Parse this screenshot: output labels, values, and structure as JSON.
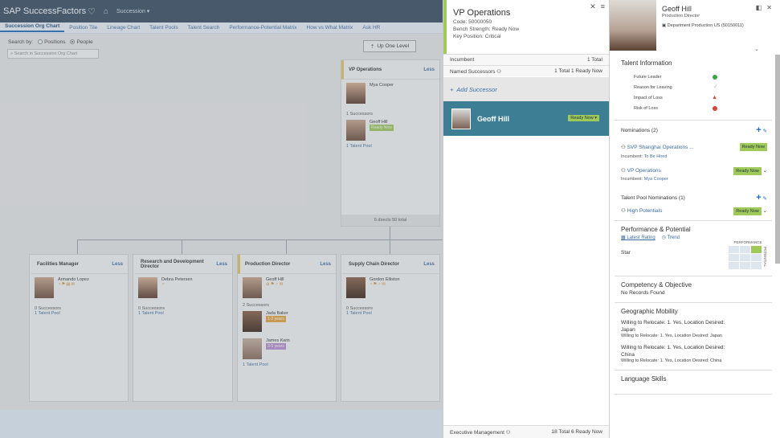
{
  "app": {
    "title": "SAP SuccessFactors",
    "module": "Succession"
  },
  "subnav": [
    "Succession Org Chart",
    "Position Tile",
    "Lineage Chart",
    "Talent Pools",
    "Talent Search",
    "Performance-Potential Matrix",
    "How vs What Matrix",
    "Ask HR"
  ],
  "search": {
    "label": "Search by:",
    "opt1": "Positions",
    "opt2": "People",
    "placeholder": "Search in Succession Org Chart"
  },
  "uplevel": "Up One Level",
  "top_node": {
    "title": "VP Operations",
    "less": "Less",
    "incumbent": "Mya Cooper",
    "succ_count": "1 Successors",
    "successor": "Geoff Hill",
    "successor_tag": "Ready Now",
    "pool": "1 Talent Pool",
    "footer": "6 directs 50 total"
  },
  "nodes": [
    {
      "title": "Facilities Manager",
      "less": "Less",
      "person": "Armando Lopez",
      "succ": "0 Successors",
      "pool": "1 Talent Pool"
    },
    {
      "title": "Research and Development Director",
      "less": "Less",
      "person": "Debra Petersen",
      "succ": "0 Successors",
      "pool": "1 Talent Pool"
    },
    {
      "title": "Production Director",
      "less": "Less",
      "person": "Geoff Hill",
      "succ": "2 Successors",
      "s1": "Jada Baker",
      "s1tag": "1-2 years",
      "s2": "James Kwin",
      "s2tag": "3-5 years",
      "pool": "1 Talent Pool"
    },
    {
      "title": "Supply Chain Director",
      "less": "Less",
      "person": "Gordon Elliston",
      "succ": "0 Successors",
      "pool": "1 Talent Pool"
    }
  ],
  "mid": {
    "title": "VP Operations",
    "code": "Code: 50000050",
    "bench": "Bench Strength: Ready Now",
    "key": "Key Position: Critical",
    "incumbent_label": "Incumbent",
    "incumbent_val": "1 Total",
    "named_label": "Named Successors",
    "named_val": "1 Total 1 Ready Now",
    "add": "Add Successor",
    "succ_name": "Geoff Hill",
    "succ_tag": "Ready Now",
    "footer_label": "Executive Management",
    "footer_val": "18 Total 6 Ready Now"
  },
  "right": {
    "name": "Geoff Hill",
    "role": "Production Director",
    "dept": "Department Production US (50150011)",
    "ti_title": "Talent Information",
    "ti": [
      {
        "label": "Future Leader",
        "color": "#3aa54a"
      },
      {
        "label": "Reason for Leaving",
        "color": "#c58ad8"
      },
      {
        "label": "Impact of Loss",
        "color": "#d9433b"
      },
      {
        "label": "Risk of Loss",
        "color": "#d9433b"
      }
    ],
    "nominations": "Nominations (2)",
    "nom1": "SVP Shanghai Operations ...",
    "nom1tag": "Ready Now",
    "nom1inc": "Incumbent:",
    "nom1incval": "To Be Hired",
    "nom2": "VP Operations",
    "nom2tag": "Ready Now",
    "nom2inc": "Incumbent:",
    "nom2incval": "Mya Cooper",
    "tpn": "Talent Pool Nominations (1)",
    "pool": "High Potentials",
    "pooltag": "Ready Now",
    "perf_title": "Performance & Potential",
    "latest": "Latest Rating",
    "trend": "Trend",
    "star": "Star",
    "perf_axis": "PERFORMANCE",
    "pot_axis": "POTENTIAL",
    "comp_title": "Competency & Objective",
    "comp_text": "No Records Found",
    "geo_title": "Geographic Mobility",
    "geo1": "Willing to Relocate: 1. Yes, Location Desired:",
    "geo1b": "Japan",
    "geo1c": "Willing to Relocate: 1. Yes, Location Desired: Japan",
    "geo2": "Willing to Relocate: 1. Yes, Location Desired:",
    "geo2b": "China",
    "geo2c": "Willing to Relocate: 1. Yes, Location Desired: China",
    "lang_title": "Language Skills"
  }
}
